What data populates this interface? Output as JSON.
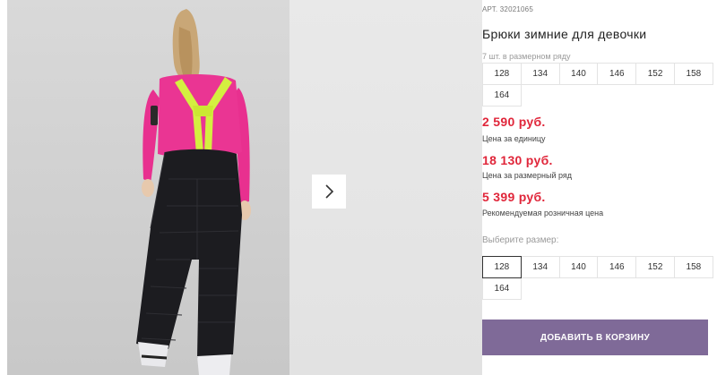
{
  "product": {
    "article_label": "АРТ.",
    "article_number": "32021065",
    "title": "Брюки зимние для девочки",
    "pack_note": "7 шт. в размерном ряду"
  },
  "pack_sizes": [
    "128",
    "134",
    "140",
    "146",
    "152",
    "158",
    "164"
  ],
  "prices": {
    "unit_price": "2 590 руб.",
    "unit_label": "Цена за единицу",
    "pack_price": "18 130 руб.",
    "pack_label": "Цена за размерный ряд",
    "retail_price": "5 399 руб.",
    "retail_label": "Рекомендуемая розничная цена",
    "price_color": "#e0263a"
  },
  "size_select": {
    "label": "Выберите размер:",
    "options": [
      "128",
      "134",
      "140",
      "146",
      "152",
      "158",
      "164"
    ],
    "selected": "128"
  },
  "cart_button": {
    "label": "ДОБАВИТЬ В КОРЗИНУ",
    "color": "#7f6a98"
  },
  "gallery": {
    "next_icon": "chevron-right-icon"
  }
}
